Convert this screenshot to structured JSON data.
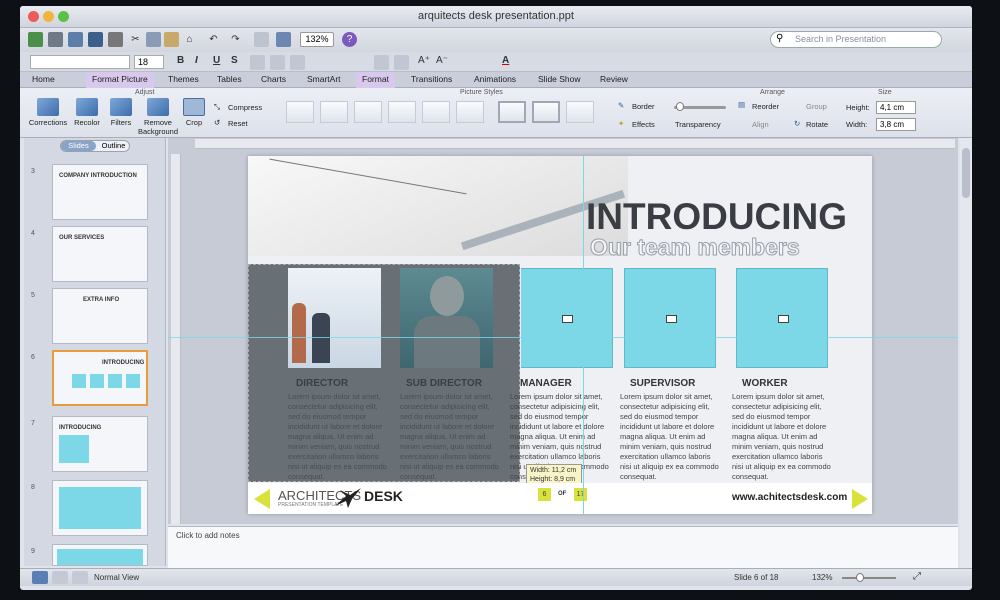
{
  "window": {
    "title": "arquitects desk presentation.ppt"
  },
  "toolbar": {
    "zoom": "132%",
    "search_placeholder": "Search in Presentation"
  },
  "format_bar": {
    "font_size": "18",
    "bold": "B",
    "italic": "I",
    "underline": "U",
    "shadow": "S"
  },
  "tabs": [
    "Home",
    "Format Picture",
    "Themes",
    "Tables",
    "Charts",
    "SmartArt",
    "Format",
    "Transitions",
    "Animations",
    "Slide Show",
    "Review"
  ],
  "ribbon": {
    "adjust_title": "Adjust",
    "picture_styles_title": "Picture Styles",
    "arrange_title": "Arrange",
    "size_title": "Size",
    "corrections": "Corrections",
    "recolor": "Recolor",
    "filters": "Filters",
    "remove_background": "Remove Background",
    "crop": "Crop",
    "compress": "Compress",
    "reset": "Reset",
    "border": "Border",
    "effects": "Effects",
    "transparency": "Transparency",
    "reorder": "Reorder",
    "group": "Group",
    "align": "Align",
    "rotate": "Rotate",
    "height_label": "Height:",
    "height_value": "4,1 cm",
    "width_label": "Width:",
    "width_value": "3,8 cm"
  },
  "left_pane": {
    "tab_slides": "Slides",
    "tab_outline": "Outline",
    "thumbnails": [
      {
        "num": "3",
        "title": "COMPANY INTRODUCTION"
      },
      {
        "num": "4",
        "title": "OUR SERVICES"
      },
      {
        "num": "5",
        "title": "EXTRA INFO"
      },
      {
        "num": "6",
        "title": "INTRODUCING"
      },
      {
        "num": "7",
        "title": "INTRODUCING"
      },
      {
        "num": "8",
        "title": ""
      },
      {
        "num": "9",
        "title": ""
      }
    ]
  },
  "slide": {
    "heading": "INTRODUCING",
    "subheading": "Our team members",
    "members": [
      {
        "role": "DIRECTOR",
        "text": "Lorem ipsum dolor sit amet, consectetur adipisicing elit, sed do eiusmod tempor incididunt ut labore et dolore magna aliqua. Ut enim ad minim veniam, quis nostrud exercitation ullamco laboris nisi ut aliquip ex ea commodo consequat."
      },
      {
        "role": "SUB DIRECTOR",
        "text": "Lorem ipsum dolor sit amet, consectetur adipisicing elit, sed do eiusmod tempor incididunt ut labore et dolore magna aliqua. Ut enim ad minim veniam, quis nostrud exercitation ullamco laboris nisi ut aliquip ex ea commodo consequat."
      },
      {
        "role": "MANAGER",
        "text": "Lorem ipsum dolor sit amet, consectetur adipisicing elit, sed do eiusmod tempor incididunt ut labore et dolore magna aliqua. Ut enim ad minim veniam, quis nostrud exercitation ullamco laboris nisi ut aliquip ex ea commodo consequat."
      },
      {
        "role": "SUPERVISOR",
        "text": "Lorem ipsum dolor sit amet, consectetur adipisicing elit, sed do eiusmod tempor incididunt ut labore et dolore magna aliqua. Ut enim ad minim veniam, quis nostrud exercitation ullamco laboris nisi ut aliquip ex ea commodo consequat."
      },
      {
        "role": "WORKER",
        "text": "Lorem ipsum dolor sit amet, consectetur adipisicing elit, sed do eiusmod tempor incididunt ut labore et dolore magna aliqua. Ut enim ad minim veniam, quis nostrud exercitation ullamco laboris nisi ut aliquip ex ea commodo consequat."
      }
    ],
    "size_tip_width": "Width: 11,2 cm",
    "size_tip_height": "Height: 8,9 cm",
    "logo_text": "ARCHITECTS",
    "logo_sub": "PRESENTATION TEMPLATE",
    "logo_desk": "DESK",
    "page_current": "6",
    "page_of": "OF",
    "page_total": "17",
    "website": "www.achitectsdesk.com"
  },
  "notes": {
    "placeholder": "Click to add notes"
  },
  "status": {
    "view": "Normal View",
    "slide_count": "Slide 6 of 18",
    "zoom": "132%"
  },
  "colors": {
    "accent": "#d8e23a",
    "placeholder": "#7cd7e6",
    "selected_tab": "#d8c8ec"
  }
}
